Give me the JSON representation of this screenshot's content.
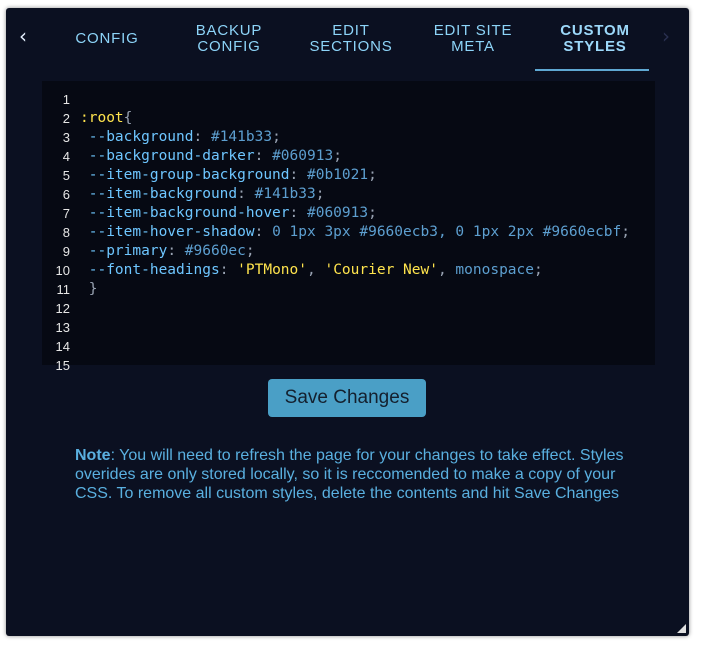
{
  "tabs": [
    {
      "label": "CONFIG",
      "active": false
    },
    {
      "label": "BACKUP\nCONFIG",
      "active": false
    },
    {
      "label": "EDIT\nSECTIONS",
      "active": false
    },
    {
      "label": "EDIT SITE\nMETA",
      "active": false
    },
    {
      "label": "CUSTOM\nSTYLES",
      "active": true
    }
  ],
  "nav": {
    "prev_icon": "chevron-left-icon",
    "next_icon": "chevron-right-icon"
  },
  "editor": {
    "line_numbers": [
      "1",
      "2",
      "3",
      "4",
      "5",
      "6",
      "7",
      "8",
      "9",
      "10",
      "11",
      "12",
      "13",
      "14",
      "15"
    ],
    "code": {
      "l2_selector": ":root",
      "l2_brace": "{",
      "l3_prop": " --background",
      "l3_val": " #141b33",
      "l4_prop": " --background-darker",
      "l4_val": " #060913",
      "l5_prop": " --item-group-background",
      "l5_val": " #0b1021",
      "l6_prop": " --item-background",
      "l6_val": " #141b33",
      "l7_prop": " --item-background-hover",
      "l7_val": " #060913",
      "l8_prop": " --item-hover-shadow",
      "l8_val": " 0 1px 3px #9660ecb3, 0 1px 2px #9660ecbf",
      "l9_prop": " --primary",
      "l9_val": " #9660ec",
      "l10_prop": " --font-headings",
      "l10_str1": " 'PTMono'",
      "l10_str2": " 'Courier New'",
      "l10_val": " monospace",
      "l11_brace": " }"
    }
  },
  "save_button": {
    "label": "Save Changes"
  },
  "note": {
    "title": "Note",
    "text": ": You will need to refresh the page for your changes to take effect. Styles overides are only stored locally, so it is reccomended to make a copy of your CSS. To remove all custom styles, delete the contents and hit Save Changes"
  },
  "colors": {
    "panel_bg": "#0b1021",
    "editor_bg": "#060913",
    "accent": "#4a9fc6"
  }
}
